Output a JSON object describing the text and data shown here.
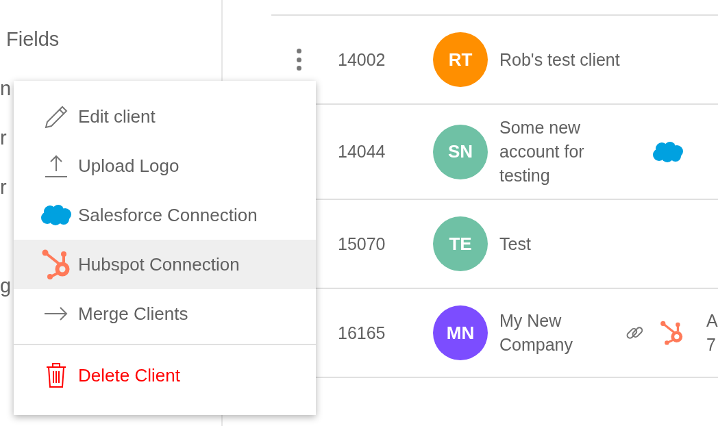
{
  "sidebar": {
    "groups": [
      [
        {
          "label": "Fields"
        },
        {
          "label": "n"
        },
        {
          "label": "r"
        },
        {
          "label": "r"
        }
      ],
      [
        {
          "label": "g"
        }
      ]
    ]
  },
  "table": {
    "rows": [
      {
        "more_button": true,
        "id": "14002",
        "initials": "RT",
        "color": "#ff8f00",
        "name": "Rob's test client",
        "icons": []
      },
      {
        "more_button": false,
        "id": "14044",
        "initials": "SN",
        "color": "#6fc1a5",
        "name": "Some new account for testing",
        "icons": [
          {
            "kind": "salesforce"
          }
        ]
      },
      {
        "more_button": false,
        "id": "15070",
        "initials": "TE",
        "color": "#6fc1a5",
        "name": "Test",
        "icons": []
      },
      {
        "more_button": false,
        "id": "16165",
        "initials": "MN",
        "color": "#7c4dff",
        "name": "My New Company",
        "icons": [
          {
            "kind": "link"
          },
          {
            "kind": "hubspot"
          }
        ],
        "column_6": [
          "A",
          "7"
        ]
      }
    ]
  },
  "menu": {
    "items": [
      {
        "kind": "edit",
        "label": "Edit client",
        "selected": false
      },
      {
        "kind": "upload",
        "label": "Upload Logo",
        "selected": false
      },
      {
        "kind": "salesforce",
        "label": "Salesforce Connection",
        "selected": false
      },
      {
        "kind": "hubspot",
        "label": "Hubspot Connection",
        "selected": true
      },
      {
        "kind": "merge",
        "label": "Merge Clients",
        "selected": false
      },
      {
        "kind": "delete",
        "label": "Delete Client",
        "selected": false
      }
    ]
  }
}
